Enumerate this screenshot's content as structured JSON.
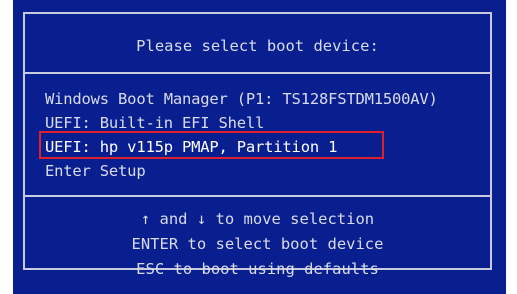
{
  "dialog": {
    "title": "Please select boot device:"
  },
  "boot_menu": {
    "items": [
      {
        "label": "Windows Boot Manager (P1: TS128FSTDM1500AV)",
        "selected": false
      },
      {
        "label": "UEFI: Built-in EFI Shell",
        "selected": false
      },
      {
        "label": "UEFI: hp v115p PMAP, Partition 1",
        "selected": true
      },
      {
        "label": "Enter Setup",
        "selected": false
      }
    ]
  },
  "help": {
    "lines": [
      "↑ and ↓ to move selection",
      "ENTER to select boot device",
      "ESC to boot using defaults"
    ]
  },
  "colors": {
    "background": "#0a1f8f",
    "text": "#d8dbea",
    "border": "#c8cbe0",
    "highlight_box": "#e0202a"
  }
}
